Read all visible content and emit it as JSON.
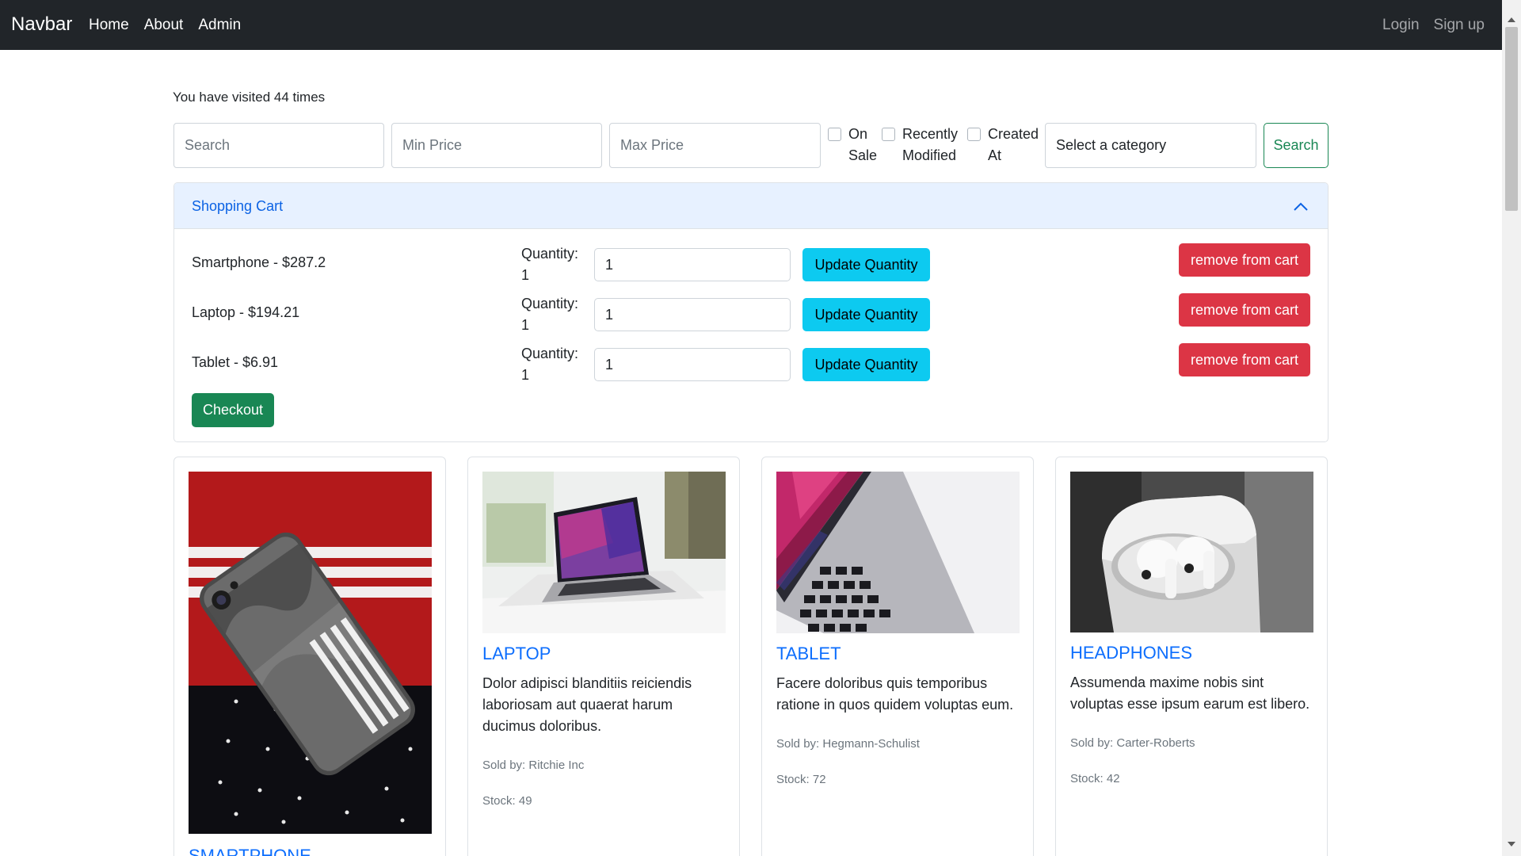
{
  "navbar": {
    "brand": "Navbar",
    "links": [
      "Home",
      "About",
      "Admin"
    ],
    "login": "Login",
    "signup": "Sign up"
  },
  "visits_text": "You have visited 44 times",
  "filters": {
    "search_placeholder": "Search",
    "min_price_placeholder": "Min Price",
    "max_price_placeholder": "Max Price",
    "checkboxes": [
      {
        "label_line1": "On",
        "label_line2": "Sale"
      },
      {
        "label_line1": "Recently",
        "label_line2": "Modified"
      },
      {
        "label_line1": "Created",
        "label_line2": "At"
      }
    ],
    "category_select": "Select a category",
    "search_button": "Search"
  },
  "cart": {
    "title": "Shopping Cart",
    "qty_label": "Quantity:",
    "update_label": "Update Quantity",
    "remove_label": "remove from cart",
    "checkout_label": "Checkout",
    "items": [
      {
        "name": "Smartphone - $287.2",
        "quantity": "1",
        "input_value": "1"
      },
      {
        "name": "Laptop - $194.21",
        "quantity": "1",
        "input_value": "1"
      },
      {
        "name": "Tablet - $6.91",
        "quantity": "1",
        "input_value": "1"
      }
    ]
  },
  "products": [
    {
      "title": "SMARTPHONE",
      "description": "",
      "sold_by": "",
      "stock": ""
    },
    {
      "title": "LAPTOP",
      "description": "Dolor adipisci blanditiis reiciendis laboriosam aut quaerat harum ducimus doloribus.",
      "sold_by": "Sold by: Ritchie Inc",
      "stock": "Stock: 49"
    },
    {
      "title": "TABLET",
      "description": "Facere doloribus quis temporibus ratione in quos quidem voluptas eum.",
      "sold_by": "Sold by: Hegmann-Schulist",
      "stock": "Stock: 72"
    },
    {
      "title": "HEADPHONES",
      "description": "Assumenda maxime nobis sint voluptas esse ipsum earum est libero.",
      "sold_by": "Sold by: Carter-Roberts",
      "stock": "Stock: 42"
    }
  ],
  "colors": {
    "navbar_bg": "#212529",
    "primary": "#0d6efd",
    "success": "#198754",
    "info": "#0dcaf0",
    "danger": "#dc3545",
    "accordion_bg": "#e7f1ff"
  }
}
